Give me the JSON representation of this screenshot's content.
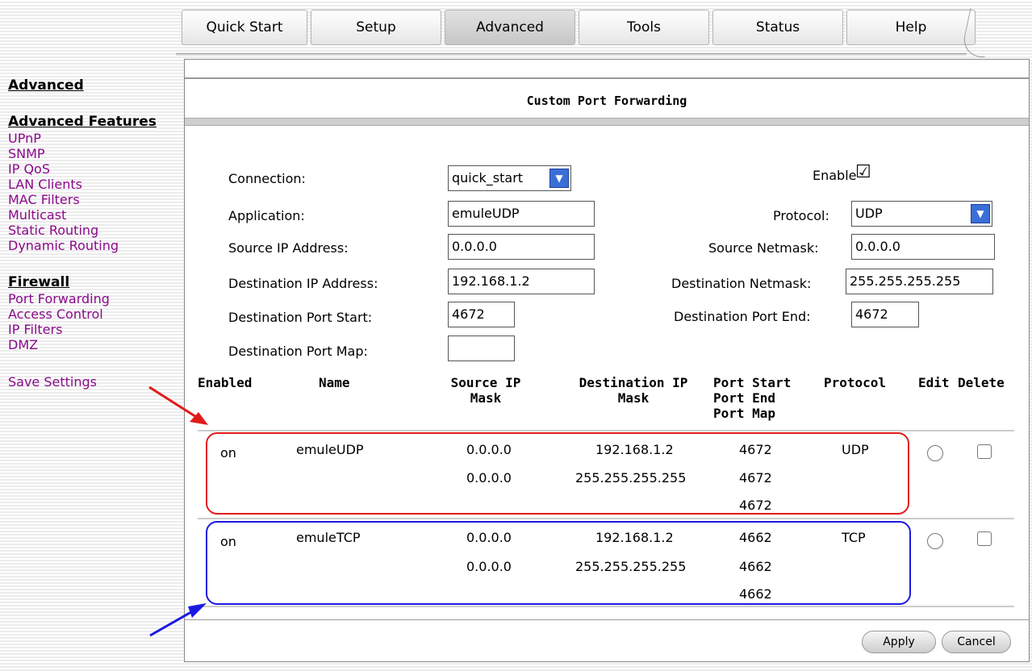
{
  "tabs": [
    "Quick Start",
    "Setup",
    "Advanced",
    "Tools",
    "Status",
    "Help"
  ],
  "active_tab": "Advanced",
  "sidebar": {
    "advanced": "Advanced",
    "advanced_features": "Advanced Features",
    "features": [
      "UPnP",
      "SNMP",
      "IP QoS",
      "LAN Clients",
      "MAC Filters",
      "Multicast",
      "Static Routing",
      "Dynamic Routing"
    ],
    "firewall": "Firewall",
    "firewall_items": [
      "Port Forwarding",
      "Access Control",
      "IP Filters",
      "DMZ"
    ],
    "save": "Save Settings"
  },
  "panel": {
    "title": "Custom Port Forwarding"
  },
  "form": {
    "connection_label": "Connection:",
    "connection_value": "quick_start",
    "enable_label": "Enable",
    "enable_checked": "☑",
    "application_label": "Application:",
    "application_value": "emuleUDP",
    "protocol_label": "Protocol:",
    "protocol_value": "UDP",
    "source_ip_label": "Source IP Address:",
    "source_ip_value": "0.0.0.0",
    "source_mask_label": "Source Netmask:",
    "source_mask_value": "0.0.0.0",
    "dest_ip_label": "Destination IP Address:",
    "dest_ip_value": "192.168.1.2",
    "dest_mask_label": "Destination Netmask:",
    "dest_mask_value": "255.255.255.255",
    "port_start_label": "Destination Port Start:",
    "port_start_value": "4672",
    "port_end_label": "Destination Port End:",
    "port_end_value": "4672",
    "port_map_label": "Destination Port Map:",
    "port_map_value": ""
  },
  "table": {
    "headers": {
      "enabled": "Enabled",
      "name": "Name",
      "source": "Source IP\nMask",
      "dest": "Destination IP\nMask",
      "ports": "Port Start\nPort End\nPort Map",
      "protocol": "Protocol",
      "edit": "Edit",
      "delete": "Delete"
    },
    "rows": [
      {
        "enabled": "on",
        "name": "emuleUDP",
        "src_ip": "0.0.0.0",
        "src_mask": "0.0.0.0",
        "dst_ip": "192.168.1.2",
        "dst_mask": "255.255.255.255",
        "port_start": "4672",
        "port_end": "4672",
        "port_map": "4672",
        "protocol": "UDP"
      },
      {
        "enabled": "on",
        "name": "emuleTCP",
        "src_ip": "0.0.0.0",
        "src_mask": "0.0.0.0",
        "dst_ip": "192.168.1.2",
        "dst_mask": "255.255.255.255",
        "port_start": "4662",
        "port_end": "4662",
        "port_map": "4662",
        "protocol": "TCP"
      }
    ]
  },
  "buttons": {
    "apply": "Apply",
    "cancel": "Cancel"
  },
  "colors": {
    "sidebar_link": "#8a0a8a",
    "highlight_red": "#e31a1a",
    "highlight_blue": "#1a1ae3"
  }
}
